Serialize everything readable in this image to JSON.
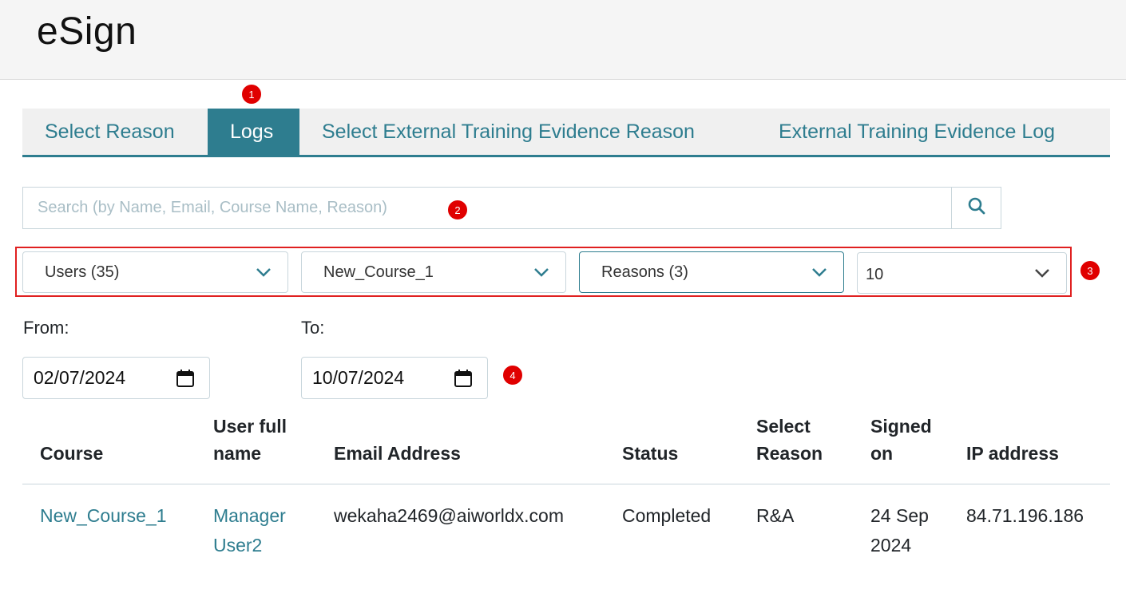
{
  "app": {
    "title": "eSign"
  },
  "annotations": [
    "1",
    "2",
    "3",
    "4"
  ],
  "tabs": [
    {
      "label": "Select Reason",
      "active": false
    },
    {
      "label": "Logs",
      "active": true
    },
    {
      "label": "Select External Training Evidence Reason",
      "active": false
    },
    {
      "label": "External Training Evidence Log",
      "active": false
    }
  ],
  "search": {
    "placeholder": "Search (by Name, Email, Course Name, Reason)",
    "value": "",
    "icon": "search-icon"
  },
  "filters": {
    "users": "Users (35)",
    "course": "New_Course_1",
    "reasons": "Reasons (3)",
    "page_size": "10"
  },
  "dates": {
    "from_label": "From:",
    "from_value": "02/07/2024",
    "to_label": "To:",
    "to_value": "10/07/2024"
  },
  "table": {
    "headers": {
      "course": "Course",
      "user_full_name_1": "User full",
      "user_full_name_2": "name",
      "email": "Email Address",
      "status": "Status",
      "select_reason_1": "Select",
      "select_reason_2": "Reason",
      "signed_on_1": "Signed",
      "signed_on_2": "on",
      "ip": "IP address"
    },
    "rows": [
      {
        "course": "New_Course_1",
        "user_1": "Manager",
        "user_2": "User2",
        "email": "wekaha2469@aiworldx.com",
        "status": "Completed",
        "reason": "R&A",
        "signed_1": "24 Sep",
        "signed_2": "2024",
        "ip": "84.71.196.186"
      }
    ]
  },
  "colors": {
    "accent": "#2e7d8f",
    "annotation": "#e00000"
  }
}
